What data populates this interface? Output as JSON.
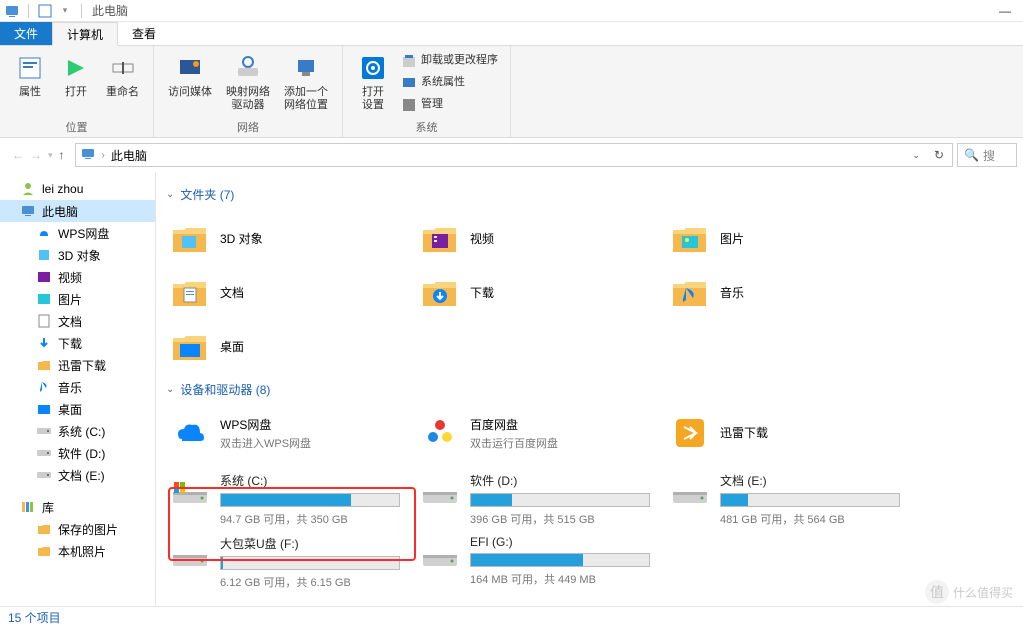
{
  "titlebar": {
    "title": "此电脑"
  },
  "tabs": {
    "file": "文件",
    "computer": "计算机",
    "view": "查看"
  },
  "ribbon": {
    "location": {
      "label": "位置",
      "props": "属性",
      "open": "打开",
      "rename": "重命名"
    },
    "network": {
      "label": "网络",
      "media": "访问媒体",
      "mapdrive": "映射网络\n驱动器",
      "addloc": "添加一个\n网络位置"
    },
    "system": {
      "label": "系统",
      "settings": "打开\n设置",
      "uninstall": "卸载或更改程序",
      "sysprops": "系统属性",
      "manage": "管理"
    }
  },
  "address": {
    "location": "此电脑",
    "search_placeholder": "搜"
  },
  "tree": {
    "user": "lei zhou",
    "thispc": "此电脑",
    "items": [
      {
        "label": "WPS网盘"
      },
      {
        "label": "3D 对象"
      },
      {
        "label": "视频"
      },
      {
        "label": "图片"
      },
      {
        "label": "文档"
      },
      {
        "label": "下载"
      },
      {
        "label": "迅雷下载"
      },
      {
        "label": "音乐"
      },
      {
        "label": "桌面"
      },
      {
        "label": "系统 (C:)"
      },
      {
        "label": "软件 (D:)"
      },
      {
        "label": "文档 (E:)"
      }
    ],
    "libraries": "库",
    "lib_items": [
      {
        "label": "保存的图片"
      },
      {
        "label": "本机照片"
      }
    ]
  },
  "content": {
    "folders_header": "文件夹 (7)",
    "folders": [
      {
        "label": "3D 对象"
      },
      {
        "label": "视频"
      },
      {
        "label": "图片"
      },
      {
        "label": "文档"
      },
      {
        "label": "下载"
      },
      {
        "label": "音乐"
      },
      {
        "label": "桌面"
      }
    ],
    "drives_header": "设备和驱动器 (8)",
    "cloud": [
      {
        "label": "WPS网盘",
        "sub": "双击进入WPS网盘"
      },
      {
        "label": "百度网盘",
        "sub": "双击运行百度网盘"
      },
      {
        "label": "迅雷下载",
        "sub": ""
      }
    ],
    "drives": [
      {
        "label": "系统 (C:)",
        "sub": "94.7 GB 可用，共 350 GB",
        "pct": 73
      },
      {
        "label": "软件 (D:)",
        "sub": "396 GB 可用，共 515 GB",
        "pct": 23
      },
      {
        "label": "文档 (E:)",
        "sub": "481 GB 可用，共 564 GB",
        "pct": 15
      },
      {
        "label": "大包菜U盘 (F:)",
        "sub": "6.12 GB 可用，共 6.15 GB",
        "pct": 1
      },
      {
        "label": "EFI (G:)",
        "sub": "164 MB 可用，共 449 MB",
        "pct": 63
      }
    ]
  },
  "statusbar": {
    "text": "15 个项目"
  },
  "watermark": {
    "text": "什么值得买"
  }
}
